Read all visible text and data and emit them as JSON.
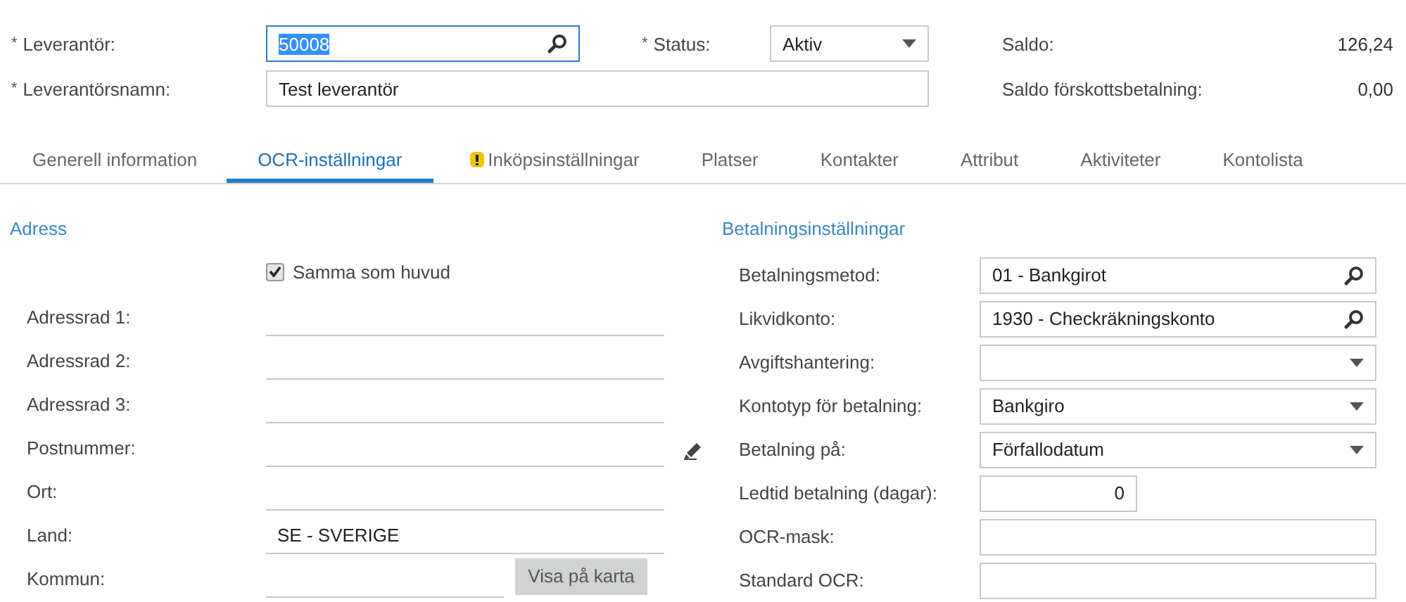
{
  "header": {
    "rows": [
      {
        "fields": [
          {
            "required_mark": "*",
            "label": "Leverantör:",
            "kind": "lookup",
            "value": "50008",
            "focused": true
          },
          {
            "required_mark": "*",
            "label": "Status:",
            "kind": "dropdown",
            "value": "Aktiv",
            "focused": false
          }
        ],
        "summary": {
          "label": "Saldo:",
          "value": "126,24"
        }
      },
      {
        "fields": [
          {
            "required_mark": "*",
            "label": "Leverantörsnamn:",
            "kind": "text",
            "value": "Test leverantör",
            "focused": false
          }
        ],
        "summary": {
          "label": "Saldo förskottsbetalning:",
          "value": "0,00"
        }
      }
    ]
  },
  "tabs": [
    {
      "label": "Generell information",
      "selected": false,
      "warning": false
    },
    {
      "label": "OCR-inställningar",
      "selected": true,
      "warning": false
    },
    {
      "label": "Inköpsinställningar",
      "selected": false,
      "warning": true
    },
    {
      "label": "Platser",
      "selected": false,
      "warning": false
    },
    {
      "label": "Kontakter",
      "selected": false,
      "warning": false
    },
    {
      "label": "Attribut",
      "selected": false,
      "warning": false
    },
    {
      "label": "Aktiviteter",
      "selected": false,
      "warning": false
    },
    {
      "label": "Kontolista",
      "selected": false,
      "warning": false
    }
  ],
  "address": {
    "title": "Adress",
    "checkbox": {
      "label": "Samma som huvud",
      "checked": true
    },
    "rows": [
      {
        "label": "Adressrad 1:",
        "kind": "line"
      },
      {
        "label": "Adressrad 2:",
        "kind": "line"
      },
      {
        "label": "Adressrad 3:",
        "kind": "line"
      },
      {
        "label": "Postnummer:",
        "kind": "line"
      },
      {
        "label": "Ort:",
        "kind": "line"
      },
      {
        "label": "Land:",
        "kind": "line",
        "value": "SE - SVERIGE"
      },
      {
        "label": "Kommun:",
        "kind": "line_with_button",
        "button": "Visa på karta"
      }
    ]
  },
  "payment": {
    "title": "Betalningsinställningar",
    "rows": [
      {
        "label": "Betalningsmetod:",
        "kind": "lookup",
        "value": "01 - Bankgirot",
        "edited": false
      },
      {
        "label": "Likvidkonto:",
        "kind": "lookup",
        "value": "1930 - Checkräkningskonto",
        "edited": false
      },
      {
        "label": "Avgiftshantering:",
        "kind": "dropdown",
        "edited": false
      },
      {
        "label": "Kontotyp för betalning:",
        "kind": "dropdown",
        "value": "Bankgiro",
        "edited": false
      },
      {
        "label": "Betalning på:",
        "kind": "dropdown",
        "value": "Förfallodatum",
        "edited": true
      },
      {
        "label": "Ledtid betalning (dagar):",
        "kind": "number",
        "value": "0",
        "edited": false
      },
      {
        "label": "OCR-mask:",
        "kind": "text",
        "edited": false
      },
      {
        "label": "Standard OCR:",
        "kind": "text",
        "edited": false
      }
    ]
  }
}
